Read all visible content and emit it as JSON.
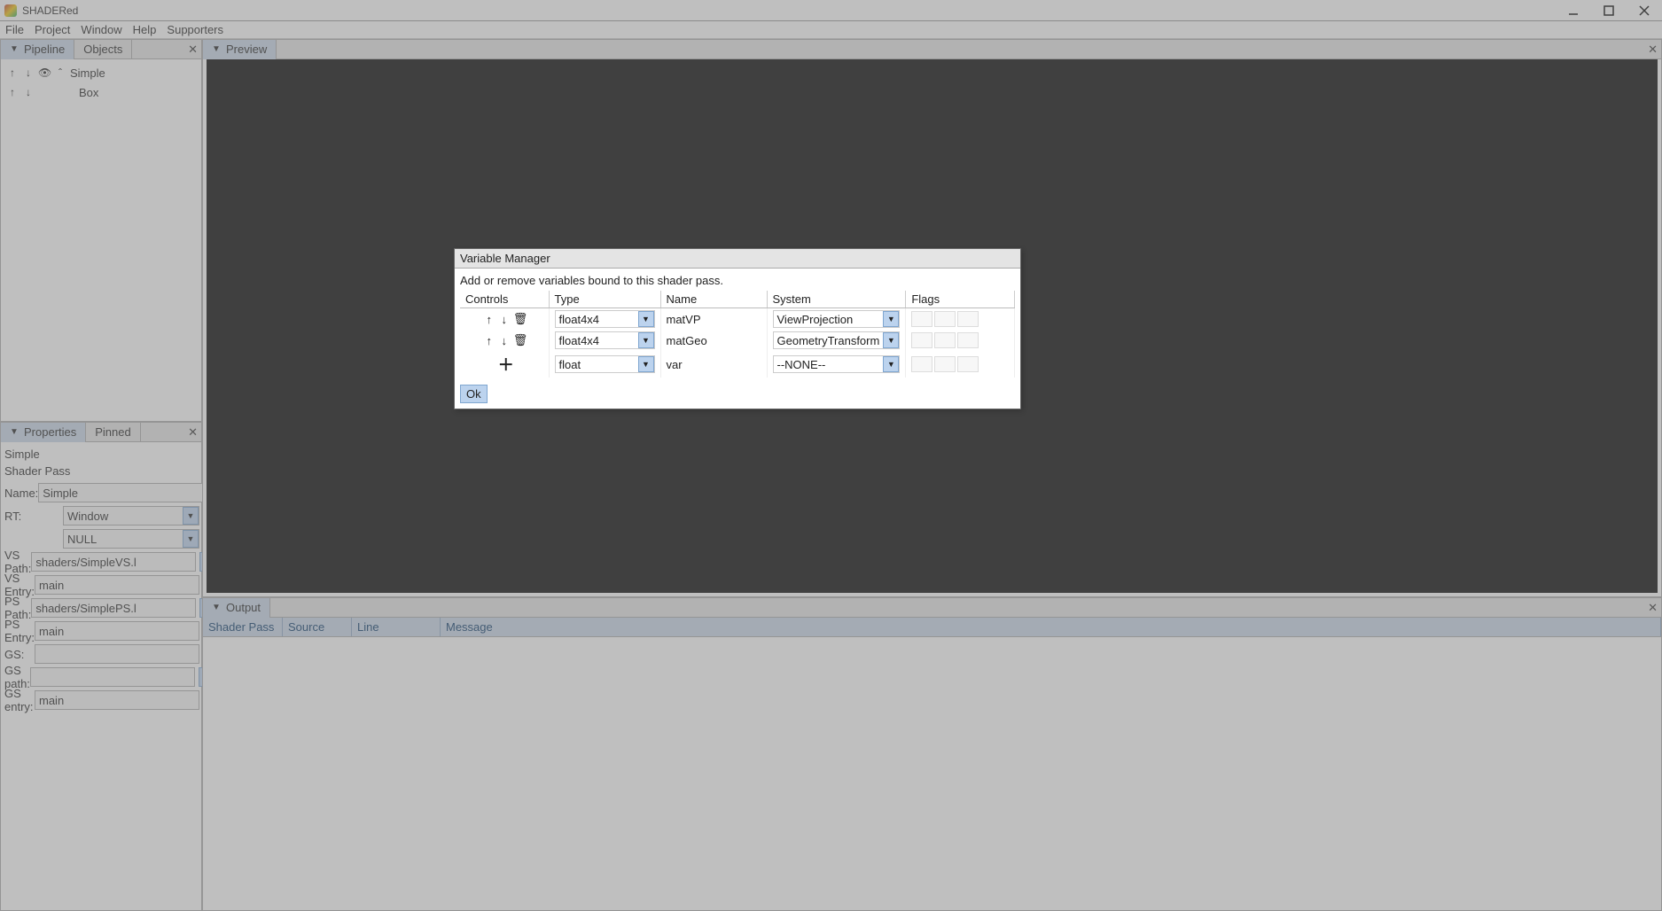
{
  "app": {
    "title": "SHADERed"
  },
  "menu": {
    "file": "File",
    "project": "Project",
    "window": "Window",
    "help": "Help",
    "supporters": "Supporters"
  },
  "panels": {
    "pipeline_tab": "Pipeline",
    "objects_tab": "Objects",
    "preview_tab": "Preview",
    "properties_tab": "Properties",
    "pinned_tab": "Pinned",
    "output_tab": "Output"
  },
  "pipeline": {
    "items": [
      {
        "label": "Simple"
      },
      {
        "label": "Box"
      }
    ]
  },
  "properties": {
    "title": "Simple",
    "subtitle": "Shader Pass",
    "name_label": "Name:",
    "name_value": "Simple",
    "ok": "Ok",
    "rt_label": "RT:",
    "rt_value1": "Window",
    "rt_value2": "NULL",
    "vs_path_label": "VS Path:",
    "vs_path_value": "shaders/SimpleVS.l",
    "vs_entry_label": "VS Entry:",
    "vs_entry_value": "main",
    "ps_path_label": "PS Path:",
    "ps_path_value": "shaders/SimplePS.l",
    "ps_entry_label": "PS Entry:",
    "ps_entry_value": "main",
    "gs_label": "GS:",
    "gs_path_label": "GS path:",
    "gs_path_value": "",
    "gs_entry_label": "GS entry:",
    "gs_entry_value": "main",
    "browse": "..."
  },
  "output": {
    "cols": {
      "shader_pass": "Shader Pass",
      "source": "Source",
      "line": "Line",
      "message": "Message"
    }
  },
  "modal": {
    "title": "Variable Manager",
    "desc": "Add or remove variables bound to this shader pass.",
    "headers": {
      "controls": "Controls",
      "type": "Type",
      "name": "Name",
      "system": "System",
      "flags": "Flags"
    },
    "rows": [
      {
        "controls": "updown-trash",
        "type": "float4x4",
        "name": "matVP",
        "system": "ViewProjection"
      },
      {
        "controls": "updown-trash",
        "type": "float4x4",
        "name": "matGeo",
        "system": "GeometryTransform"
      },
      {
        "controls": "plus",
        "type": "float",
        "name": "var",
        "system": "--NONE--"
      }
    ],
    "ok": "Ok"
  }
}
